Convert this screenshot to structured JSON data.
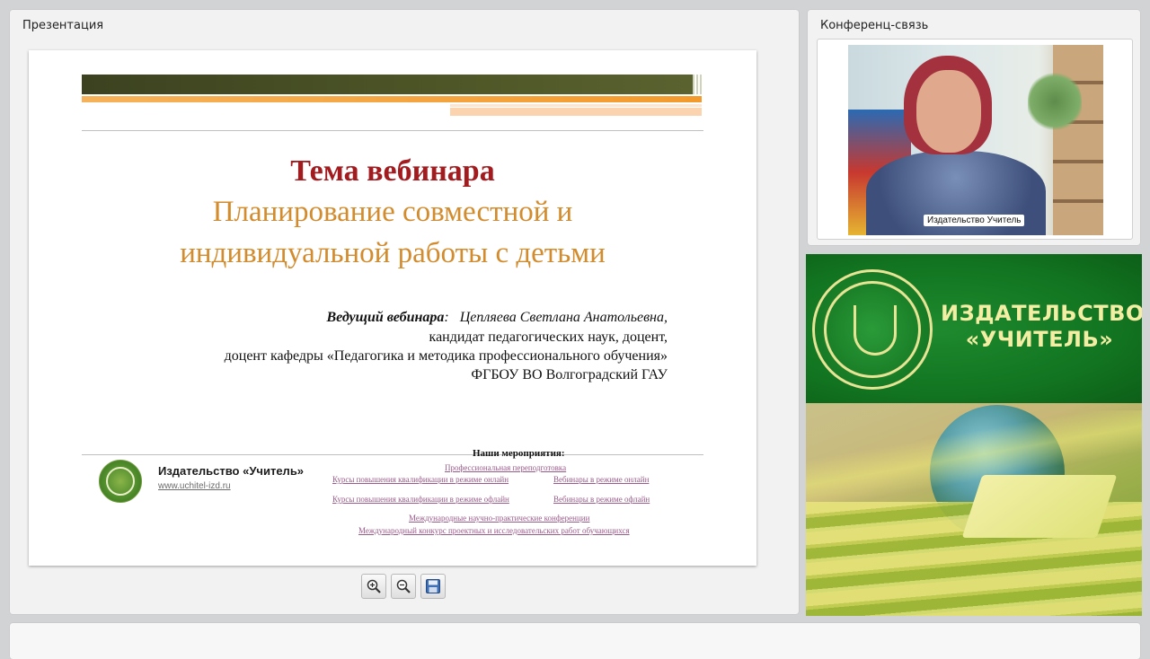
{
  "presentation": {
    "title": "Презентация",
    "slide": {
      "theme_label": "Тема вебинара",
      "subtitle_line1": "Планирование совместной и",
      "subtitle_line2": "индивидуальной работы с детьми",
      "host_label": "Ведущий вебинара",
      "host_name": "Цепляева Светлана Анатольевна,",
      "host_degree": "кандидат педагогических наук,  доцент,",
      "host_position": "доцент кафедры «Педагогика и методика профессионального обучения»",
      "host_org": "ФГБОУ ВО Волгоградский ГАУ",
      "publisher_name": "Издательство «Учитель»",
      "publisher_url": "www.uchitel-izd.ru",
      "events_title": "Наши мероприятия:",
      "events": [
        "Профессиональная переподготовка",
        "Курсы повышения квалификации в режиме онлайн",
        "Вебинары в режиме онлайн",
        "Курсы повышения квалификации в режиме офлайн",
        "Вебинары в режиме офлайн",
        "Международные научно-практические конференции",
        "Международный конкурс проектных и исследовательских работ обучающихся"
      ]
    },
    "toolbar": {
      "zoom_in_icon": "zoom-in-icon",
      "zoom_out_icon": "zoom-out-icon",
      "save_icon": "floppy-disk-icon"
    }
  },
  "conference": {
    "title": "Конференц-связь",
    "participant_label": "Издательство Учитель"
  },
  "ad": {
    "title_line1": "ИЗДАТЕЛЬСТВО",
    "title_line2": "«УЧИТЕЛЬ»"
  },
  "colors": {
    "theme_red": "#a11b1f",
    "subtitle_orange": "#d28b2d",
    "ad_green": "#127521",
    "ad_text": "#f3eea4"
  }
}
